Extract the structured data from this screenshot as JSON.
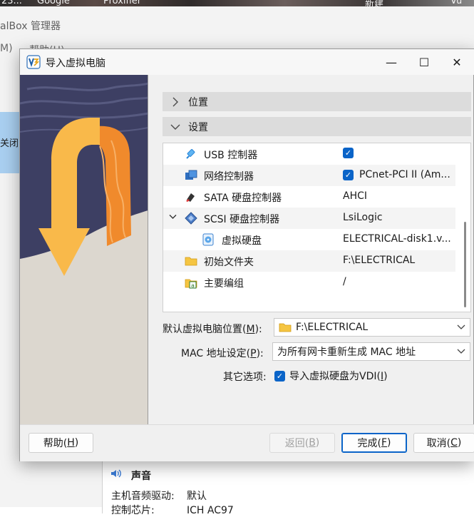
{
  "taskbar": {
    "items": [
      "23...",
      "Google",
      "Proxifier",
      "新建",
      "Vu"
    ]
  },
  "background_app": {
    "title": "alBox 管理器",
    "menu": [
      "M)",
      "帮助(H)"
    ],
    "left_button": "关闭",
    "sound_section": {
      "title": "声音",
      "rows": [
        {
          "key": "主机音频驱动:",
          "value": "默认"
        },
        {
          "key": "控制芯片:",
          "value": "ICH AC97"
        }
      ]
    }
  },
  "dialog": {
    "title": "导入虚拟电脑",
    "controls": {
      "minimize": "—",
      "maximize": "☐",
      "close": "✕"
    },
    "sections": {
      "location": "位置",
      "settings": "设置"
    },
    "tree": [
      {
        "name": "USB 控制器",
        "value": "",
        "checked": true,
        "icon": "usb-icon"
      },
      {
        "name": "网络控制器",
        "value": "PCnet-PCI II (Am...",
        "checked": true,
        "icon": "network-icon"
      },
      {
        "name": "SATA 硬盘控制器",
        "value": "AHCI",
        "icon": "sata-controller-icon"
      },
      {
        "name": "SCSI 硬盘控制器",
        "value": "LsiLogic",
        "icon": "scsi-controller-icon",
        "expanded": true
      },
      {
        "name": "虚拟硬盘",
        "value": "ELECTRICAL-disk1.v...",
        "icon": "hard-disk-icon"
      },
      {
        "name": "初始文件夹",
        "value": "F:\\ELECTRICAL",
        "icon": "folder-icon"
      },
      {
        "name": "主要编组",
        "value": "/",
        "icon": "group-icon"
      }
    ],
    "form": {
      "default_location_label_pre": "默认虚拟电脑位置(",
      "default_location_mnemonic": "M",
      "default_location_label_post": "):",
      "default_location_value": "F:\\ELECTRICAL",
      "mac_label_pre": "MAC 地址设定(",
      "mac_mnemonic": "P",
      "mac_label_post": "):",
      "mac_value": "为所有网卡重新生成 MAC 地址",
      "other_label": "其它选项:",
      "vdi_pre": "导入虚拟硬盘为VDI(",
      "vdi_mnemonic": "I",
      "vdi_post": ")",
      "vdi_checked": true
    },
    "buttons": {
      "help_pre": "帮助(",
      "help_key": "H",
      "help_post": ")",
      "back_pre": "返回(",
      "back_key": "B",
      "back_post": ")",
      "finish_pre": "完成(",
      "finish_key": "F",
      "finish_post": ")",
      "cancel_pre": "取消(",
      "cancel_key": "C",
      "cancel_post": ")"
    }
  },
  "colors": {
    "accent": "#0a64c8",
    "arrow": "#f9b94a",
    "ribbon": "#f08a2c",
    "night": "#3d3f63"
  }
}
